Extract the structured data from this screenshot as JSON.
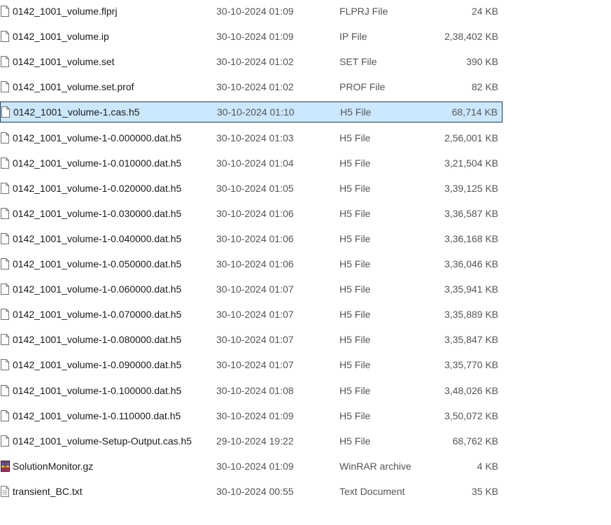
{
  "files": [
    {
      "name": "0142_1001_volume.flprj",
      "date": "30-10-2024 01:09",
      "type": "FLPRJ File",
      "size": "24 KB",
      "icon": "generic-file-icon",
      "selected": false
    },
    {
      "name": "0142_1001_volume.ip",
      "date": "30-10-2024 01:09",
      "type": "IP File",
      "size": "2,38,402 KB",
      "icon": "generic-file-icon",
      "selected": false
    },
    {
      "name": "0142_1001_volume.set",
      "date": "30-10-2024 01:02",
      "type": "SET File",
      "size": "390 KB",
      "icon": "generic-file-icon",
      "selected": false
    },
    {
      "name": "0142_1001_volume.set.prof",
      "date": "30-10-2024 01:02",
      "type": "PROF File",
      "size": "82 KB",
      "icon": "generic-file-icon",
      "selected": false
    },
    {
      "name": "0142_1001_volume-1.cas.h5",
      "date": "30-10-2024 01:10",
      "type": "H5 File",
      "size": "68,714 KB",
      "icon": "generic-file-icon",
      "selected": true
    },
    {
      "name": "0142_1001_volume-1-0.000000.dat.h5",
      "date": "30-10-2024 01:03",
      "type": "H5 File",
      "size": "2,56,001 KB",
      "icon": "generic-file-icon",
      "selected": false
    },
    {
      "name": "0142_1001_volume-1-0.010000.dat.h5",
      "date": "30-10-2024 01:04",
      "type": "H5 File",
      "size": "3,21,504 KB",
      "icon": "generic-file-icon",
      "selected": false
    },
    {
      "name": "0142_1001_volume-1-0.020000.dat.h5",
      "date": "30-10-2024 01:05",
      "type": "H5 File",
      "size": "3,39,125 KB",
      "icon": "generic-file-icon",
      "selected": false
    },
    {
      "name": "0142_1001_volume-1-0.030000.dat.h5",
      "date": "30-10-2024 01:06",
      "type": "H5 File",
      "size": "3,36,587 KB",
      "icon": "generic-file-icon",
      "selected": false
    },
    {
      "name": "0142_1001_volume-1-0.040000.dat.h5",
      "date": "30-10-2024 01:06",
      "type": "H5 File",
      "size": "3,36,168 KB",
      "icon": "generic-file-icon",
      "selected": false
    },
    {
      "name": "0142_1001_volume-1-0.050000.dat.h5",
      "date": "30-10-2024 01:06",
      "type": "H5 File",
      "size": "3,36,046 KB",
      "icon": "generic-file-icon",
      "selected": false
    },
    {
      "name": "0142_1001_volume-1-0.060000.dat.h5",
      "date": "30-10-2024 01:07",
      "type": "H5 File",
      "size": "3,35,941 KB",
      "icon": "generic-file-icon",
      "selected": false
    },
    {
      "name": "0142_1001_volume-1-0.070000.dat.h5",
      "date": "30-10-2024 01:07",
      "type": "H5 File",
      "size": "3,35,889 KB",
      "icon": "generic-file-icon",
      "selected": false
    },
    {
      "name": "0142_1001_volume-1-0.080000.dat.h5",
      "date": "30-10-2024 01:07",
      "type": "H5 File",
      "size": "3,35,847 KB",
      "icon": "generic-file-icon",
      "selected": false
    },
    {
      "name": "0142_1001_volume-1-0.090000.dat.h5",
      "date": "30-10-2024 01:07",
      "type": "H5 File",
      "size": "3,35,770 KB",
      "icon": "generic-file-icon",
      "selected": false
    },
    {
      "name": "0142_1001_volume-1-0.100000.dat.h5",
      "date": "30-10-2024 01:08",
      "type": "H5 File",
      "size": "3,48,026 KB",
      "icon": "generic-file-icon",
      "selected": false
    },
    {
      "name": "0142_1001_volume-1-0.110000.dat.h5",
      "date": "30-10-2024 01:09",
      "type": "H5 File",
      "size": "3,50,072 KB",
      "icon": "generic-file-icon",
      "selected": false
    },
    {
      "name": "0142_1001_volume-Setup-Output.cas.h5",
      "date": "29-10-2024 19:22",
      "type": "H5 File",
      "size": "68,762 KB",
      "icon": "generic-file-icon",
      "selected": false
    },
    {
      "name": "SolutionMonitor.gz",
      "date": "30-10-2024 01:09",
      "type": "WinRAR archive",
      "size": "4 KB",
      "icon": "winrar-archive-icon",
      "selected": false
    },
    {
      "name": "transient_BC.txt",
      "date": "30-10-2024 00:55",
      "type": "Text Document",
      "size": "35 KB",
      "icon": "text-document-icon",
      "selected": false
    }
  ],
  "colors": {
    "selection_bg": "#cce8ff",
    "selection_border": "#1f3b57",
    "name_text": "#1a1a1a",
    "meta_text": "#555555"
  }
}
